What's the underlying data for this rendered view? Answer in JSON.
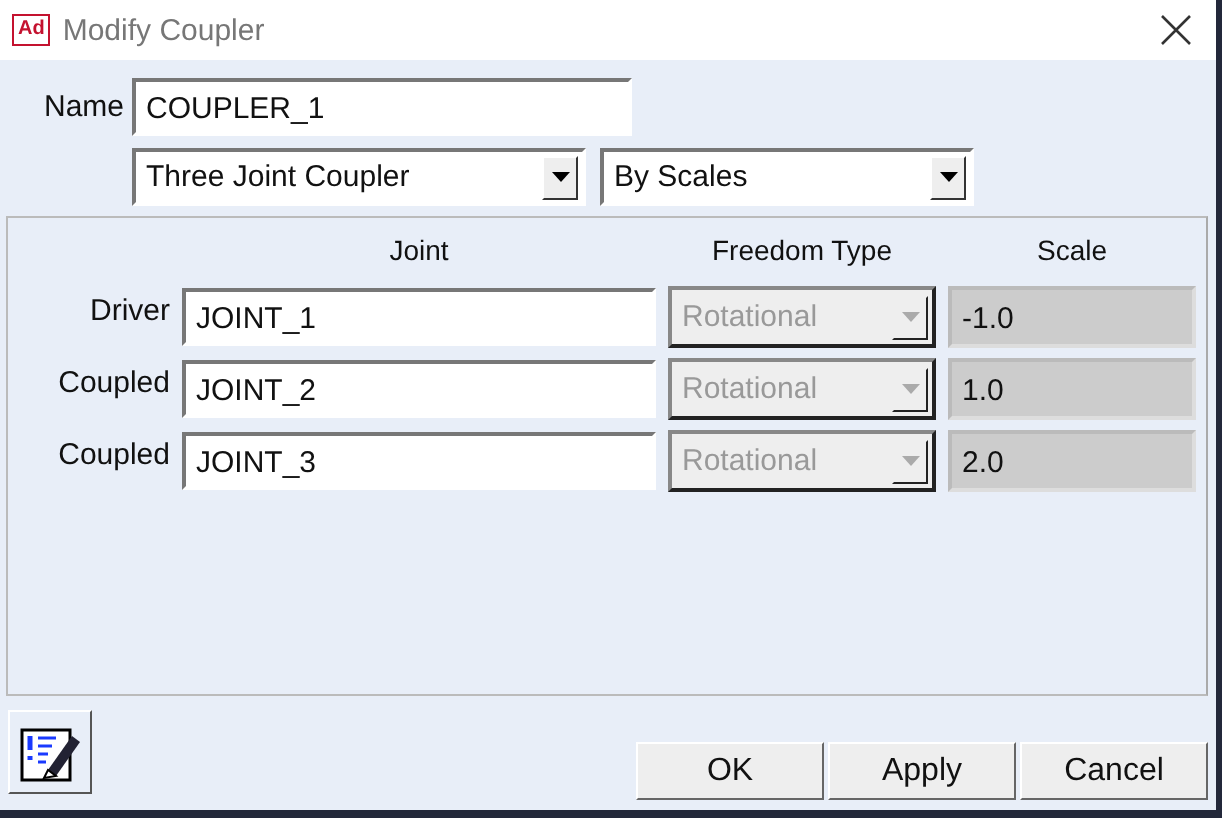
{
  "window": {
    "title": "Modify Coupler",
    "app_icon": "Ad"
  },
  "name_field": {
    "label": "Name",
    "value": "COUPLER_1"
  },
  "coupler_type": {
    "value": "Three Joint Coupler"
  },
  "method": {
    "value": "By Scales"
  },
  "table": {
    "columns": [
      "Joint",
      "Freedom Type",
      "Scale"
    ],
    "rows": [
      {
        "label": "Driver",
        "joint": "JOINT_1",
        "freedom_type": "Rotational",
        "freedom_disabled": true,
        "scale": "-1.0",
        "scale_disabled": true
      },
      {
        "label": "Coupled",
        "joint": "JOINT_2",
        "freedom_type": "Rotational",
        "freedom_disabled": true,
        "scale": "1.0",
        "scale_disabled": true
      },
      {
        "label": "Coupled",
        "joint": "JOINT_3",
        "freedom_type": "Rotational",
        "freedom_disabled": true,
        "scale": "2.0",
        "scale_disabled": true
      }
    ]
  },
  "buttons": [
    "OK",
    "Apply",
    "Cancel"
  ]
}
